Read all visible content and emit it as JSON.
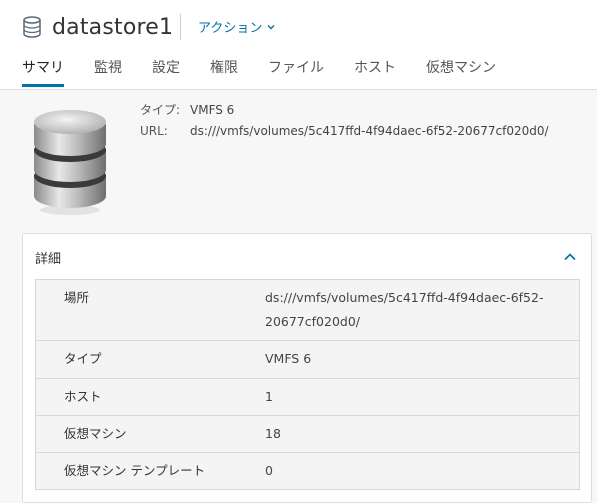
{
  "header": {
    "title": "datastore1",
    "icon": "datastore-icon",
    "actions_label": "アクション"
  },
  "tabs": [
    {
      "label": "サマリ",
      "active": true
    },
    {
      "label": "監視",
      "active": false
    },
    {
      "label": "設定",
      "active": false
    },
    {
      "label": "権限",
      "active": false
    },
    {
      "label": "ファイル",
      "active": false
    },
    {
      "label": "ホスト",
      "active": false
    },
    {
      "label": "仮想マシン",
      "active": false
    }
  ],
  "summary": {
    "type_label": "タイプ:",
    "type_value": "VMFS 6",
    "url_label": "URL:",
    "url_value": "ds:///vmfs/volumes/5c417ffd-4f94daec-6f52-20677cf020d0/"
  },
  "details": {
    "title": "詳細",
    "rows": [
      {
        "label": "場所",
        "value": "ds:///vmfs/volumes/5c417ffd-4f94daec-6f52-20677cf020d0/"
      },
      {
        "label": "タイプ",
        "value": "VMFS 6"
      },
      {
        "label": "ホスト",
        "value": "1"
      },
      {
        "label": "仮想マシン",
        "value": "18"
      },
      {
        "label": "仮想マシン テンプレート",
        "value": "0"
      }
    ]
  },
  "colors": {
    "accent": "#0072a3",
    "background": "#f7f7f7",
    "card": "#ffffff"
  }
}
